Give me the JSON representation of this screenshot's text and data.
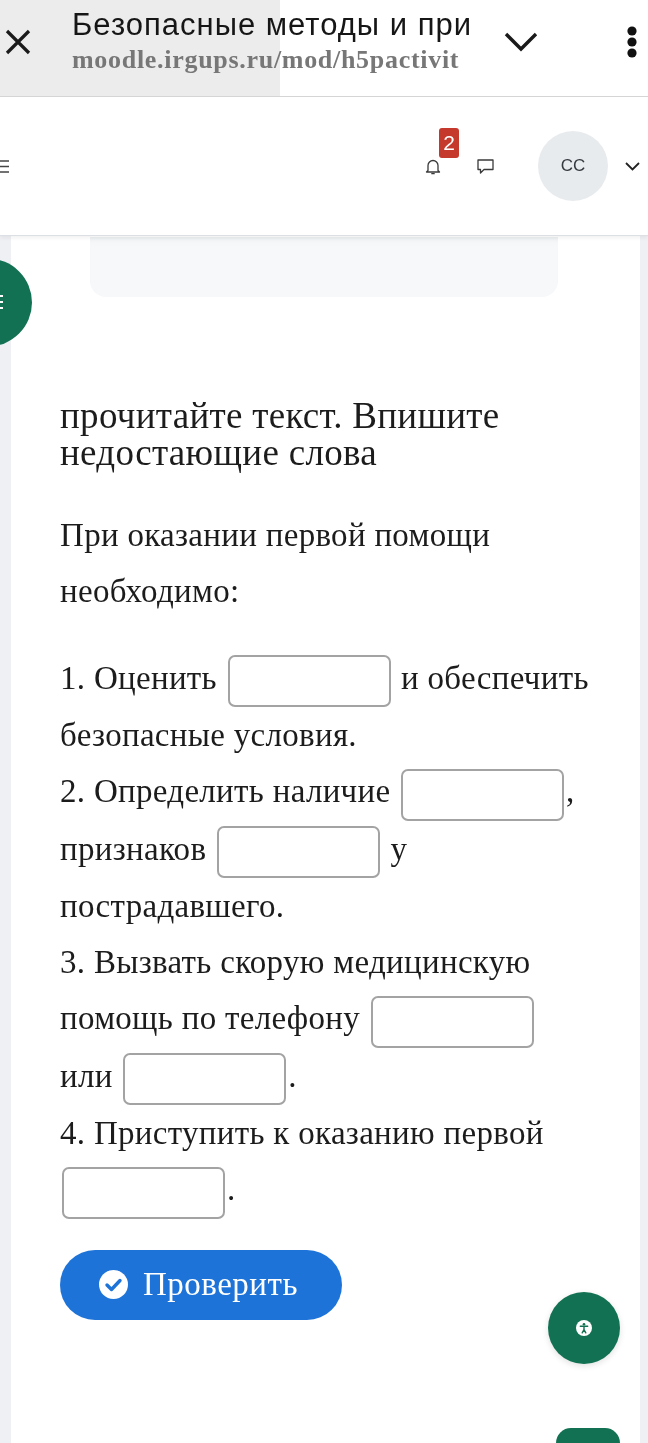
{
  "browser": {
    "title": "Безопасные методы и при",
    "url": "moodle.irgups.ru/mod/h5pactivit"
  },
  "header": {
    "notifications_badge": "2",
    "avatar_initials": "CC"
  },
  "task": {
    "title": "прочитайте текст. Впишите недостающие слова",
    "intro": "При оказании первой помощи необходимо:",
    "items": [
      {
        "parts": [
          {
            "kind": "text",
            "text": "1. Оценить"
          },
          {
            "kind": "blank"
          },
          {
            "kind": "text",
            "text": "и обеспечить"
          },
          {
            "kind": "text",
            "text": "безопасные условия."
          }
        ]
      },
      {
        "parts": [
          {
            "kind": "text",
            "text": "2. Определить наличие"
          },
          {
            "kind": "blank"
          },
          {
            "kind": "text",
            "text": ",",
            "attached": true
          },
          {
            "kind": "text",
            "text": "признаков"
          },
          {
            "kind": "blank"
          },
          {
            "kind": "text",
            "text": "у"
          },
          {
            "kind": "text",
            "text": "пострадавшего."
          }
        ]
      },
      {
        "parts": [
          {
            "kind": "text",
            "text": "3. Вызвать скорую медицинскую"
          },
          {
            "kind": "text",
            "text": "помощь по телефону"
          },
          {
            "kind": "blank"
          },
          {
            "kind": "text",
            "text": "или"
          },
          {
            "kind": "blank"
          },
          {
            "kind": "text",
            "text": ".",
            "attached": true
          }
        ]
      },
      {
        "parts": [
          {
            "kind": "text",
            "text": "4. Приступить к оказанию первой"
          },
          {
            "kind": "blank"
          },
          {
            "kind": "text",
            "text": ".",
            "attached": true
          }
        ]
      }
    ]
  },
  "check_button": {
    "label": "Проверить"
  }
}
